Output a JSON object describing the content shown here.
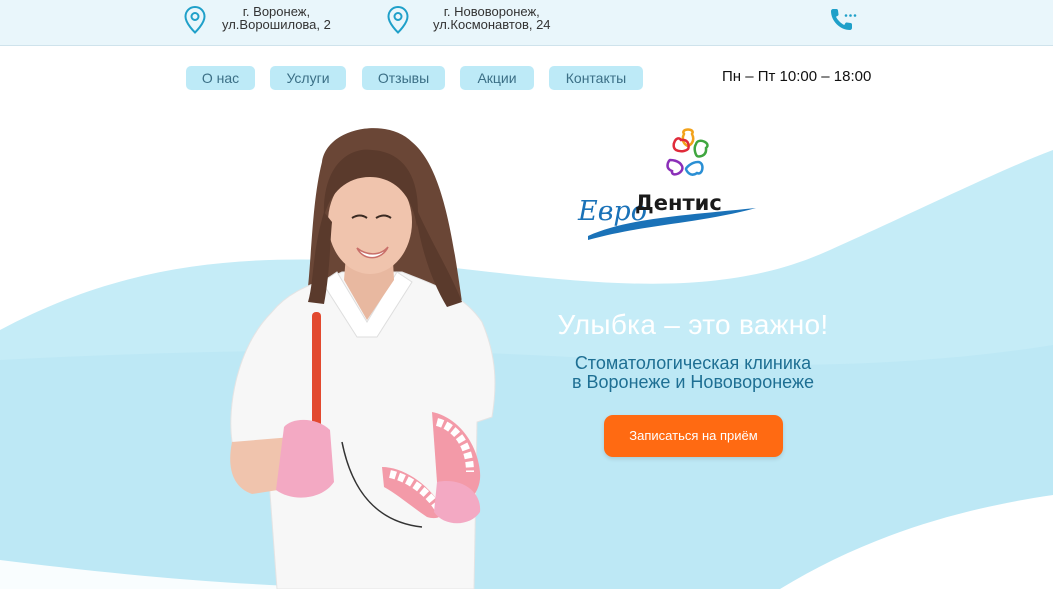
{
  "topbar": {
    "address1": {
      "line1": "г. Воронеж,",
      "line2": "ул.Ворошилова, 2"
    },
    "address2": {
      "line1": "г. Нововоронеж,",
      "line2": "ул.Космонавтов, 24"
    },
    "icons": [
      "location-pin-icon",
      "location-pin-icon",
      "phone-icon"
    ]
  },
  "nav": {
    "items": [
      {
        "label": "О нас"
      },
      {
        "label": "Услуги"
      },
      {
        "label": "Отзывы"
      },
      {
        "label": "Акции"
      },
      {
        "label": "Контакты"
      }
    ],
    "hours": "Пн – Пт 10:00 – 18:00"
  },
  "logo": {
    "text_evro": "Евро",
    "text_dentis": "Дентис"
  },
  "hero": {
    "title": "Улыбка – это важно!",
    "subtitle_line1": "Стоматологическая клиника",
    "subtitle_line2": "в Воронеже и Нововоронеже",
    "cta_label": "Записаться на приём"
  },
  "colors": {
    "accent": "#ff6a12",
    "nav_bg": "#bdeaf7",
    "wave": "#bfe9f5",
    "subtitle": "#1e6f93",
    "icon": "#1fa0c9"
  }
}
